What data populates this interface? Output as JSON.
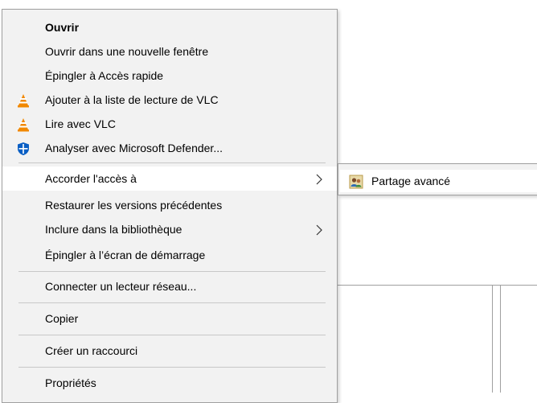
{
  "context_menu": {
    "items": [
      {
        "label": "Ouvrir",
        "icon": null
      },
      {
        "label": "Ouvrir dans une nouvelle fenêtre",
        "icon": null
      },
      {
        "label": "Épingler à Accès rapide",
        "icon": null
      },
      {
        "label": "Ajouter à la liste de lecture de VLC",
        "icon": "vlc-icon"
      },
      {
        "label": "Lire avec VLC",
        "icon": "vlc-icon"
      },
      {
        "label": "Analyser avec Microsoft Defender...",
        "icon": "defender-shield-icon"
      },
      {
        "label": "Accorder l'accès à",
        "icon": null,
        "submenu": true,
        "highlighted": true
      },
      {
        "label": "Restaurer les versions précédentes",
        "icon": null
      },
      {
        "label": "Inclure dans la bibliothèque",
        "icon": null,
        "submenu": true
      },
      {
        "label": "Épingler à l’écran de démarrage",
        "icon": null
      },
      {
        "label": "Connecter un lecteur réseau...",
        "icon": null
      },
      {
        "label": "Copier",
        "icon": null
      },
      {
        "label": "Créer un raccourci",
        "icon": null
      },
      {
        "label": "Propriétés",
        "icon": null
      }
    ]
  },
  "submenu": {
    "items": [
      {
        "label": "Partage avancé",
        "icon": "users-share-icon"
      }
    ]
  },
  "colors": {
    "menu_bg": "#f2f2f2",
    "highlight_bg": "#ffffff",
    "border": "#a0a0a0",
    "separator": "#c8c8c8",
    "vlc_orange": "#f18800",
    "defender_blue": "#0a5fc4"
  }
}
